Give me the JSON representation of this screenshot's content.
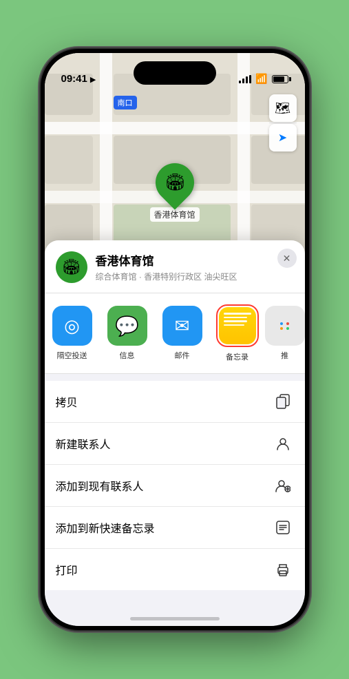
{
  "status": {
    "time": "09:41",
    "time_icon": "navigation-arrow"
  },
  "map": {
    "location_label": "南口",
    "pin_label": "香港体育馆",
    "pin_emoji": "🏟"
  },
  "venue": {
    "name": "香港体育馆",
    "description": "综合体育馆 · 香港特别行政区 油尖旺区",
    "icon_emoji": "🏟"
  },
  "share_items": [
    {
      "id": "airdrop",
      "label": "隔空投送"
    },
    {
      "id": "messages",
      "label": "信息"
    },
    {
      "id": "mail",
      "label": "邮件"
    },
    {
      "id": "notes",
      "label": "备忘录"
    },
    {
      "id": "more",
      "label": "推"
    }
  ],
  "actions": [
    {
      "id": "copy",
      "label": "拷贝",
      "icon": "📋"
    },
    {
      "id": "new-contact",
      "label": "新建联系人",
      "icon": "👤"
    },
    {
      "id": "add-existing",
      "label": "添加到现有联系人",
      "icon": "👤"
    },
    {
      "id": "add-notes",
      "label": "添加到新快速备忘录",
      "icon": "🗒"
    },
    {
      "id": "print",
      "label": "打印",
      "icon": "🖨"
    }
  ],
  "close_label": "×"
}
